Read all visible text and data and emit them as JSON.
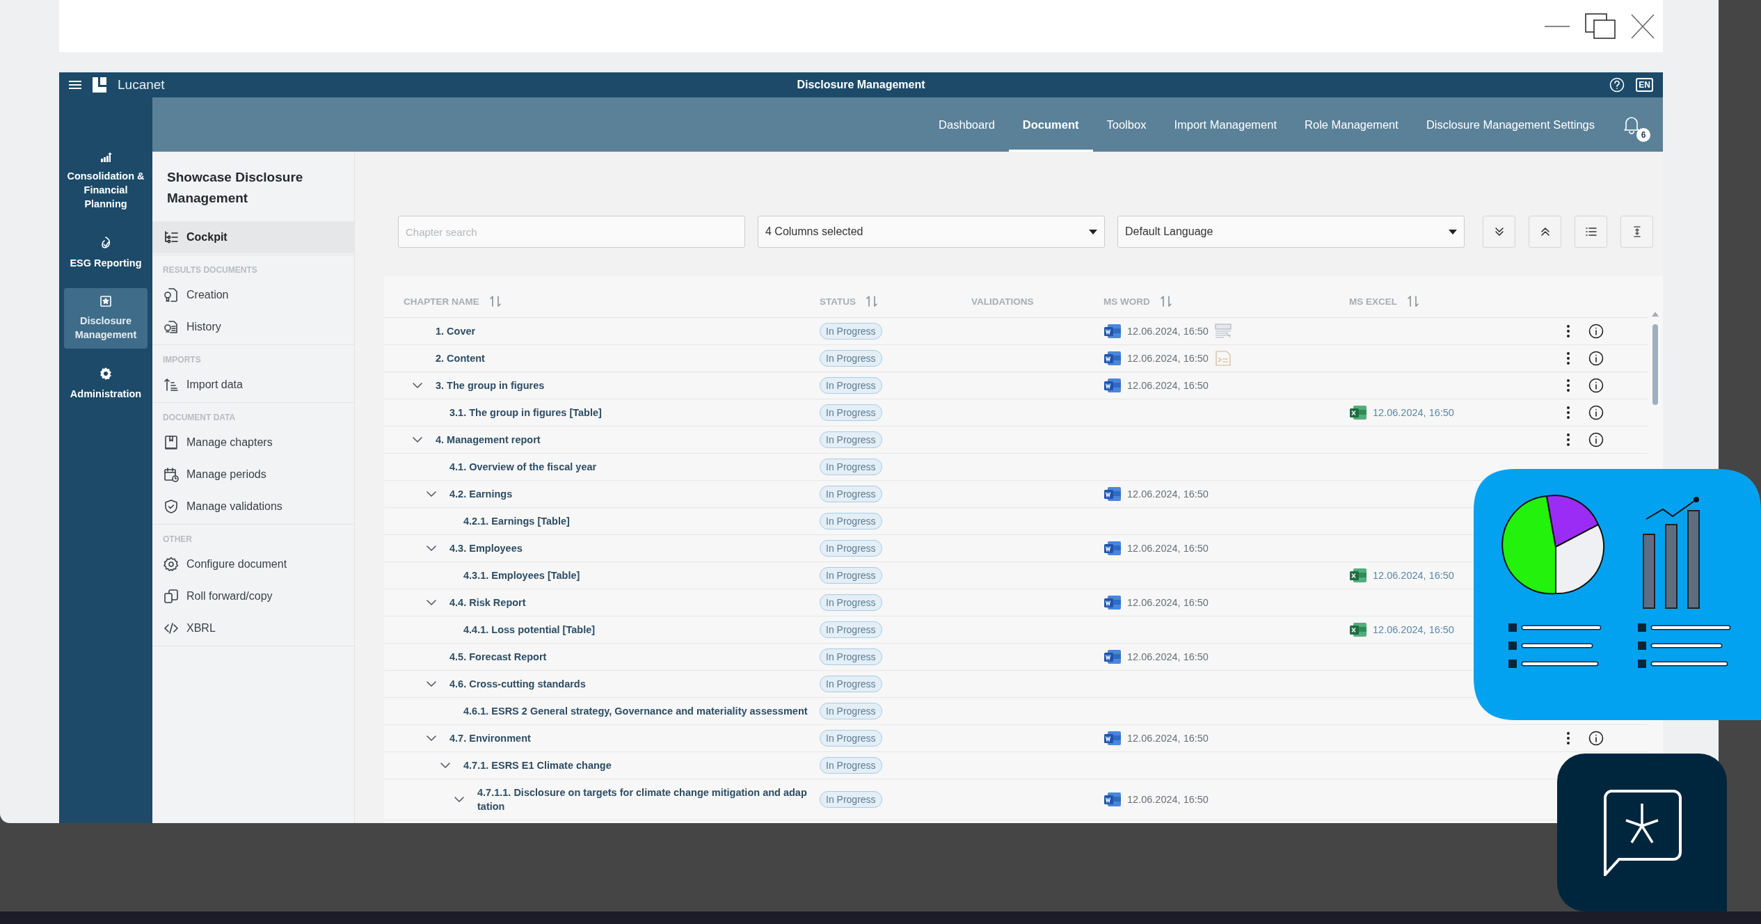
{
  "app": {
    "brand": "Lucanet",
    "title": "Disclosure Management",
    "language": "EN"
  },
  "nav_tabs": [
    {
      "label": "Dashboard",
      "selected": false
    },
    {
      "label": "Document",
      "selected": true
    },
    {
      "label": "Toolbox",
      "selected": false
    },
    {
      "label": "Import Management",
      "selected": false
    },
    {
      "label": "Role Management",
      "selected": false
    },
    {
      "label": "Disclosure Management Settings",
      "selected": false
    }
  ],
  "notifications": {
    "count": "6"
  },
  "rail": [
    {
      "label": "Consolidation & Financial Planning",
      "kind": "chart",
      "selected": false
    },
    {
      "label": "ESG Reporting",
      "kind": "esg",
      "selected": false
    },
    {
      "label": "Disclosure Management",
      "kind": "disclosure",
      "selected": true
    },
    {
      "label": "Administration",
      "kind": "admin",
      "selected": false
    }
  ],
  "sidebar": {
    "title": "Showcase Disclosure Management",
    "sections": [
      {
        "items": [
          {
            "label": "Cockpit",
            "kind": "cockpit",
            "selected": true
          }
        ]
      },
      {
        "heading": "RESULTS DOCUMENTS",
        "items": [
          {
            "label": "Creation",
            "kind": "creation",
            "selected": false
          },
          {
            "label": "History",
            "kind": "history",
            "selected": false
          }
        ]
      },
      {
        "heading": "IMPORTS",
        "items": [
          {
            "label": "Import data",
            "kind": "import",
            "selected": false
          }
        ]
      },
      {
        "heading": "DOCUMENT DATA",
        "items": [
          {
            "label": "Manage chapters",
            "kind": "chapters",
            "selected": false
          },
          {
            "label": "Manage periods",
            "kind": "periods",
            "selected": false
          },
          {
            "label": "Manage validations",
            "kind": "validations",
            "selected": false
          }
        ]
      },
      {
        "heading": "OTHER",
        "items": [
          {
            "label": "Configure document",
            "kind": "configure",
            "selected": false
          },
          {
            "label": "Roll forward/copy",
            "kind": "copy",
            "selected": false
          },
          {
            "label": "XBRL",
            "kind": "code",
            "selected": false
          }
        ]
      }
    ]
  },
  "toolbar": {
    "search": {
      "placeholder": "Chapter search"
    },
    "columns_select": {
      "value": "4 Columns selected"
    },
    "language_select": {
      "value": "Default Language"
    }
  },
  "table": {
    "columns": [
      {
        "label": "CHAPTER NAME",
        "sortable": true
      },
      {
        "label": "STATUS",
        "sortable": true
      },
      {
        "label": "VALIDATIONS",
        "sortable": false
      },
      {
        "label": "MS WORD",
        "sortable": true
      },
      {
        "label": "MS EXCEL",
        "sortable": true
      }
    ],
    "rows": [
      {
        "name": "1. Cover",
        "status": "In Progress",
        "word": "12.06.2024, 16:50",
        "attachment": {
          "kind": "layout"
        },
        "actions": true
      },
      {
        "name": "2. Content",
        "status": "In Progress",
        "word": "12.06.2024, 16:50",
        "attachment": {
          "kind": "document"
        },
        "actions": true
      },
      {
        "name": "3. The group in figures",
        "status": "In Progress",
        "word": "12.06.2024, 16:50",
        "actions": true,
        "expanded": true,
        "children": [
          {
            "name": "3.1. The group in figures [Table]",
            "status": "In Progress",
            "excel": "12.06.2024, 16:50",
            "actions": true
          }
        ]
      },
      {
        "name": "4. Management report",
        "status": "In Progress",
        "actions": true,
        "expanded": true,
        "children": [
          {
            "name": "4.1. Overview of the fiscal year",
            "status": "In Progress",
            "actions": false
          },
          {
            "name": "4.2. Earnings",
            "status": "In Progress",
            "word": "12.06.2024, 16:50",
            "actions": false,
            "expanded": true,
            "children": [
              {
                "name": "4.2.1. Earnings [Table]",
                "status": "In Progress",
                "actions": false
              }
            ]
          },
          {
            "name": "4.3. Employees",
            "status": "In Progress",
            "word": "12.06.2024, 16:50",
            "actions": false,
            "expanded": true,
            "children": [
              {
                "name": "4.3.1. Employees [Table]",
                "status": "In Progress",
                "excel": "12.06.2024, 16:50",
                "actions": false
              }
            ]
          },
          {
            "name": "4.4. Risk Report",
            "status": "In Progress",
            "word": "12.06.2024, 16:50",
            "actions": false,
            "expanded": true,
            "children": [
              {
                "name": "4.4.1. Loss potential [Table]",
                "status": "In Progress",
                "excel": "12.06.2024, 16:50",
                "actions": false
              }
            ]
          },
          {
            "name": "4.5. Forecast Report",
            "status": "In Progress",
            "word": "12.06.2024, 16:50",
            "actions": false
          },
          {
            "name": "4.6. Cross-cutting standards",
            "status": "In Progress",
            "actions": false,
            "expanded": true,
            "children": [
              {
                "name": "4.6.1. ESRS 2 General strategy, Governance and materiality assessment",
                "status": "In Progress",
                "actions": false
              }
            ]
          },
          {
            "name": "4.7. Environment",
            "status": "In Progress",
            "word": "12.06.2024, 16:50",
            "actions": true,
            "expanded": true,
            "children": [
              {
                "name": "4.7.1. ESRS E1 Climate change",
                "status": "In Progress",
                "actions": false,
                "expanded": true,
                "children": [
                  {
                    "name": "4.7.1.1. Disclosure on targets for climate change mitigation and adap tation",
                    "status": "In Progress",
                    "word": "12.06.2024, 16:50",
                    "actions": false,
                    "expanded": true
                  }
                ]
              }
            ]
          }
        ]
      }
    ]
  }
}
